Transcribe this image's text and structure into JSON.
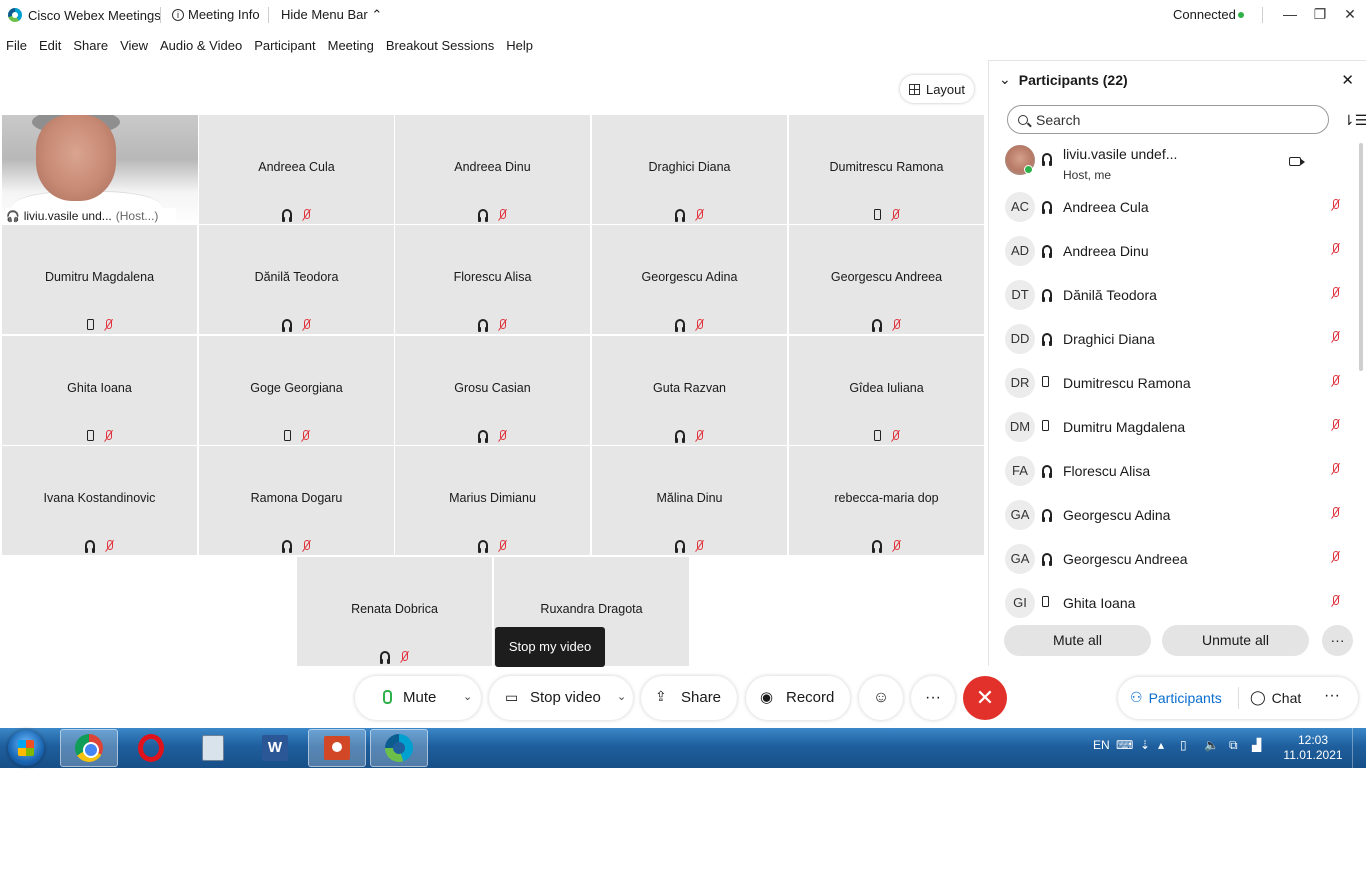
{
  "window": {
    "app_title": "Cisco Webex Meetings",
    "meeting_info": "Meeting Info",
    "hide_menu_bar": "Hide Menu Bar",
    "status": "Connected"
  },
  "menu": [
    "File",
    "Edit",
    "Share",
    "View",
    "Audio & Video",
    "Participant",
    "Meeting",
    "Breakout Sessions",
    "Help"
  ],
  "layout_button": "Layout",
  "host_tile": {
    "name": "liviu.vasile und...",
    "role": "(Host...)"
  },
  "tiles": [
    {
      "name": "Andreea Cula",
      "device": "headset"
    },
    {
      "name": "Andreea Dinu",
      "device": "headset"
    },
    {
      "name": "Draghici Diana",
      "device": "headset"
    },
    {
      "name": "Dumitrescu Ramona",
      "device": "phone"
    },
    {
      "name": "Dumitru Magdalena",
      "device": "phone"
    },
    {
      "name": "Dănilă Teodora",
      "device": "headset"
    },
    {
      "name": "Florescu Alisa",
      "device": "headset"
    },
    {
      "name": "Georgescu Adina",
      "device": "headset"
    },
    {
      "name": "Georgescu Andreea",
      "device": "headset"
    },
    {
      "name": "Ghita Ioana",
      "device": "phone"
    },
    {
      "name": "Goge Georgiana",
      "device": "phone"
    },
    {
      "name": "Grosu Casian",
      "device": "headset"
    },
    {
      "name": "Guta Razvan",
      "device": "headset"
    },
    {
      "name": "Gîdea Iuliana",
      "device": "phone"
    },
    {
      "name": "Ivana Kostandinovic",
      "device": "headset"
    },
    {
      "name": "Ramona Dogaru",
      "device": "headset"
    },
    {
      "name": "Marius Dimianu",
      "device": "headset"
    },
    {
      "name": "Mălina Dinu",
      "device": "headset"
    },
    {
      "name": "rebecca-maria dop",
      "device": "headset"
    },
    {
      "name": "Renata Dobrica",
      "device": "headset"
    },
    {
      "name": "Ruxandra Dragota",
      "device": "none"
    }
  ],
  "tooltip": "Stop my video",
  "controls": {
    "mute": "Mute",
    "stop_video": "Stop video",
    "share": "Share",
    "record": "Record",
    "more": "···",
    "end": "✕"
  },
  "panel": {
    "title": "Participants (22)",
    "search_placeholder": "Search",
    "host": {
      "name": "liviu.vasile undef...",
      "sub": "Host, me"
    },
    "participants": [
      {
        "initials": "AC",
        "name": "Andreea Cula",
        "device": "headset"
      },
      {
        "initials": "AD",
        "name": "Andreea Dinu",
        "device": "headset"
      },
      {
        "initials": "DT",
        "name": "Dănilă Teodora",
        "device": "headset"
      },
      {
        "initials": "DD",
        "name": "Draghici Diana",
        "device": "headset"
      },
      {
        "initials": "DR",
        "name": "Dumitrescu Ramona",
        "device": "phone"
      },
      {
        "initials": "DM",
        "name": "Dumitru Magdalena",
        "device": "phone"
      },
      {
        "initials": "FA",
        "name": "Florescu Alisa",
        "device": "headset"
      },
      {
        "initials": "GA",
        "name": "Georgescu Adina",
        "device": "headset"
      },
      {
        "initials": "GA",
        "name": "Georgescu Andreea",
        "device": "headset"
      },
      {
        "initials": "GI",
        "name": "Ghita Ioana",
        "device": "phone"
      }
    ],
    "mute_all": "Mute all",
    "unmute_all": "Unmute all",
    "more": "···"
  },
  "tabs": {
    "participants": "Participants",
    "chat": "Chat",
    "more": "···"
  },
  "taskbar": {
    "language": "EN",
    "time": "12:03",
    "date": "11.01.2021"
  },
  "colors": {
    "accent": "#0a6ed1",
    "end_call": "#e2312a",
    "muted_mic": "#e0303a",
    "connected": "#2fb14a"
  }
}
